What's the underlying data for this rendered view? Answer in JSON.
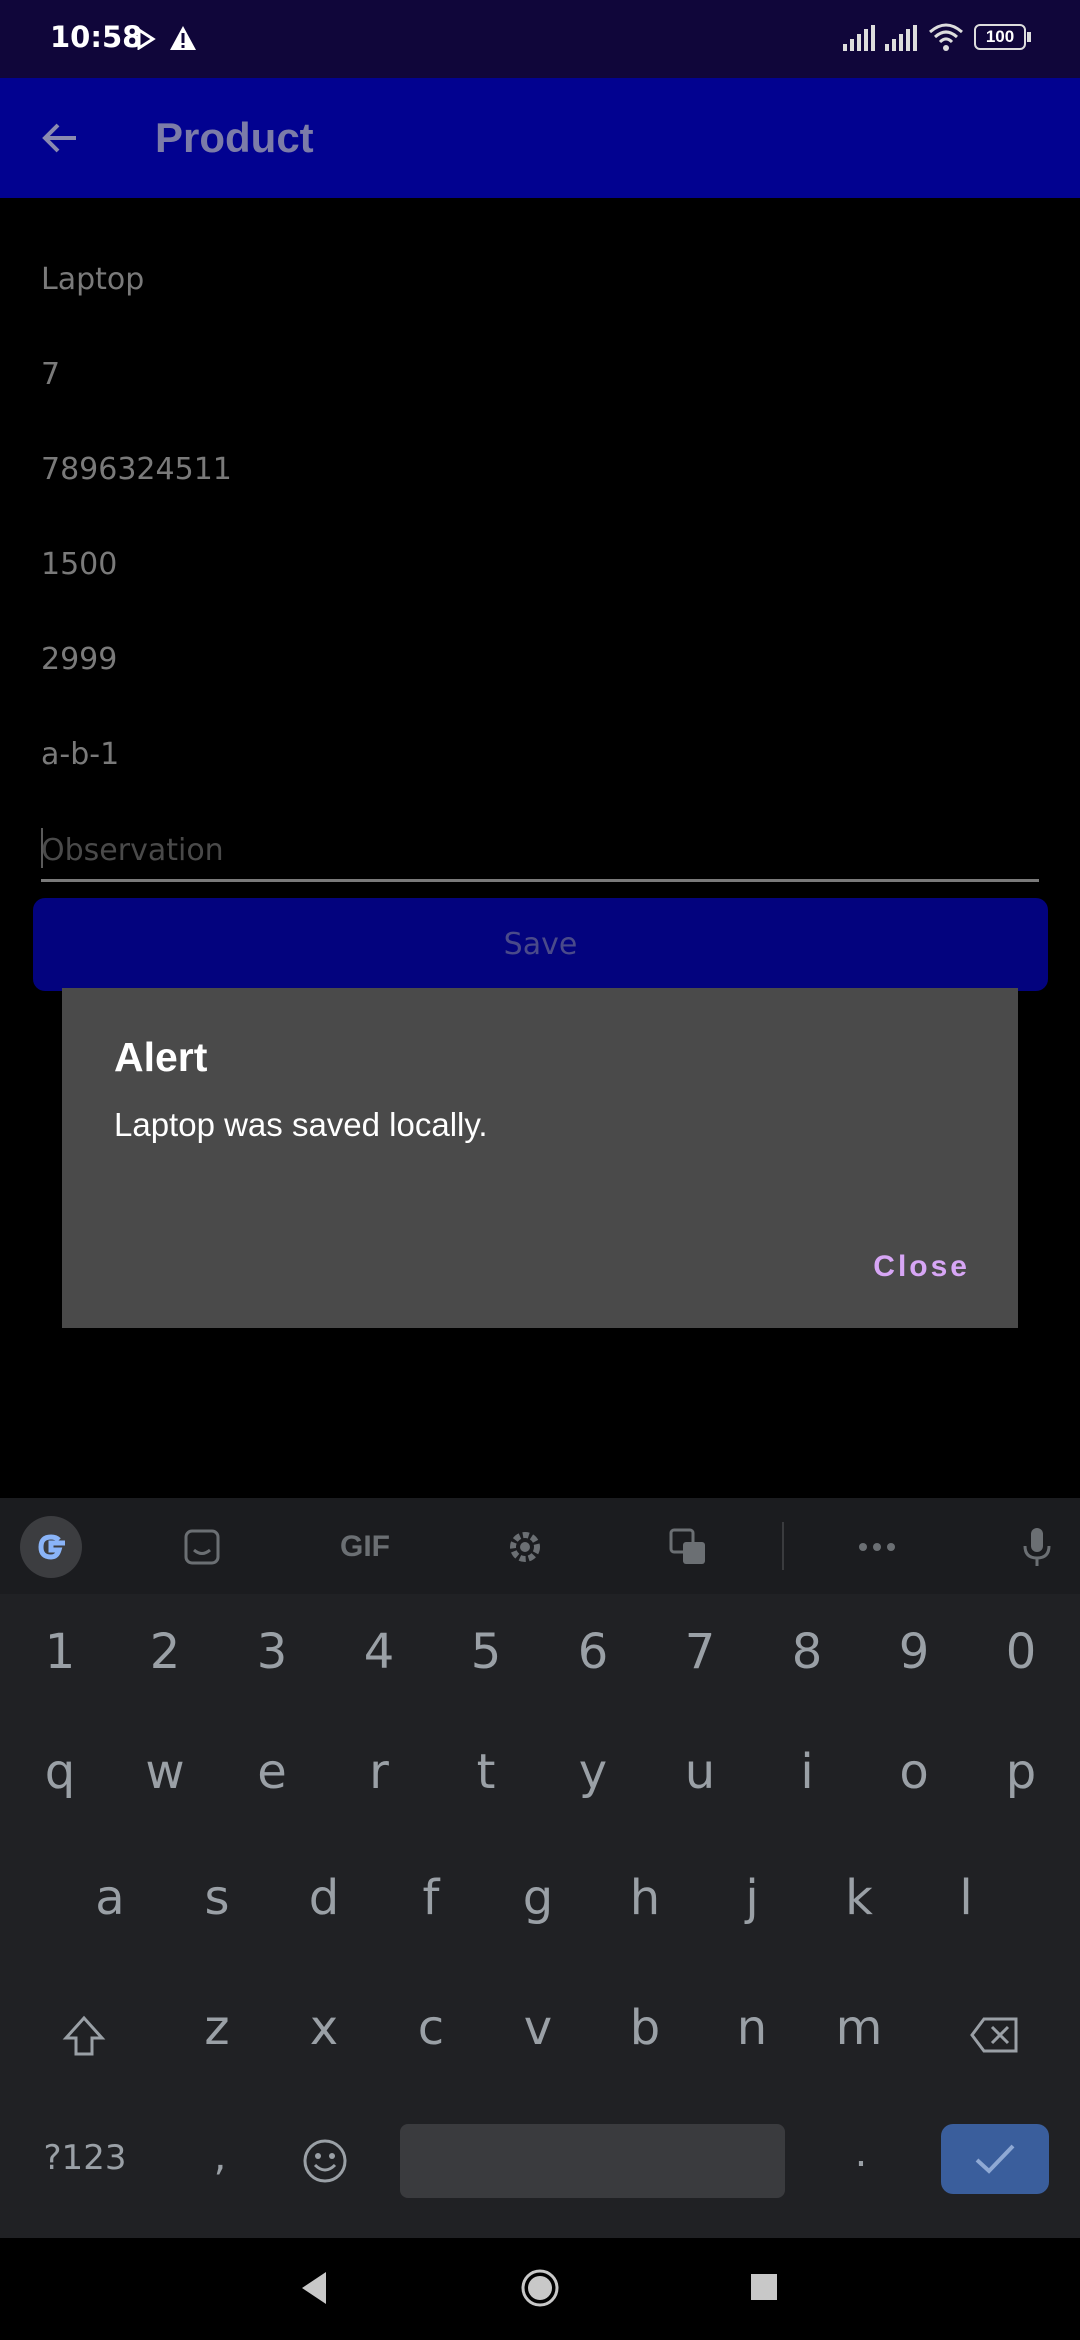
{
  "status_bar": {
    "time": "10:58",
    "battery": "100"
  },
  "app_bar": {
    "title": "Product"
  },
  "form": {
    "values": [
      "Laptop",
      "7",
      "7896324511",
      "1500",
      "2999",
      "a-b-1"
    ],
    "observation_placeholder": "Observation",
    "save_label": "Save"
  },
  "dialog": {
    "title": "Alert",
    "message": "Laptop was saved locally.",
    "close_label": "Close"
  },
  "keyboard": {
    "toolbar": [
      "google-icon",
      "sticker-icon",
      "GIF",
      "gear-icon",
      "translate-icon",
      "more-icon",
      "mic-icon"
    ],
    "gif_label": "GIF",
    "row_numbers": [
      "1",
      "2",
      "3",
      "4",
      "5",
      "6",
      "7",
      "8",
      "9",
      "0"
    ],
    "row_1": [
      "q",
      "w",
      "e",
      "r",
      "t",
      "y",
      "u",
      "i",
      "o",
      "p"
    ],
    "row_2": [
      "a",
      "s",
      "d",
      "f",
      "g",
      "h",
      "j",
      "k",
      "l"
    ],
    "row_3": [
      "z",
      "x",
      "c",
      "v",
      "b",
      "n",
      "m"
    ],
    "symbols_label": "?123",
    "comma": ",",
    "period": "."
  },
  "colors": {
    "status_bar": "#10063a",
    "app_bar": "#020290",
    "save_button": "#03037e",
    "dialog_bg": "#4a4a4a",
    "dialog_action": "#d7a6f5",
    "keyboard_bg": "#202124",
    "enter_key": "#3a5e9c"
  }
}
